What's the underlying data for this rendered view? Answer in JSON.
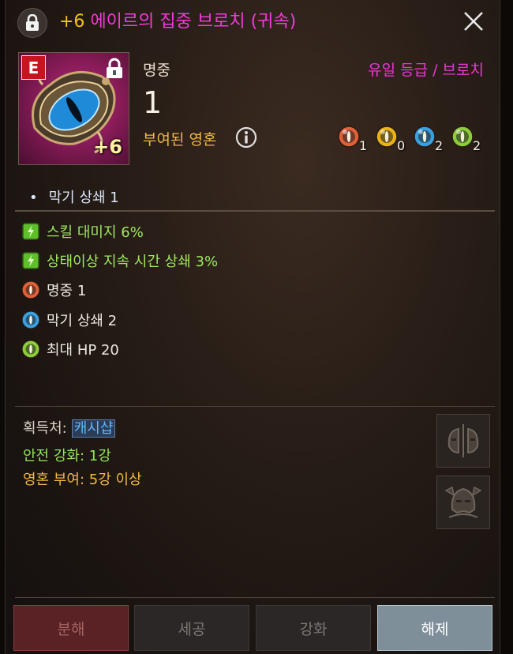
{
  "header": {
    "enhance_prefix": "+6",
    "item_name": "에이르의 집중 브로치 (귀속)",
    "plus_color": "#f3c21a",
    "name_color": "#f33ad9"
  },
  "item": {
    "grade_badge": "E",
    "enhance_badge": "+6",
    "icon": "eye-brooch-icon"
  },
  "main_stat": {
    "label": "명중",
    "value": "1"
  },
  "grade_type": "유일 등급 / 브로치",
  "soul": {
    "label": "부여된 영혼",
    "orbs": [
      {
        "color": "#e0603a",
        "count": "1"
      },
      {
        "color": "#e8b21a",
        "count": "0"
      },
      {
        "color": "#3aa0e0",
        "count": "2"
      },
      {
        "color": "#8dcc3a",
        "count": "2"
      }
    ]
  },
  "base_options": [
    "막기 상쇄  1"
  ],
  "bonus_options": [
    {
      "text": "스킬 대미지 6%",
      "icon": "skill-rune-icon",
      "color": "green"
    },
    {
      "text": "상태이상 지속 시간 상쇄 3%",
      "icon": "skill-rune-icon",
      "color": "green"
    },
    {
      "text": "명중  1",
      "icon": "red-soul-orb-icon",
      "color": "white"
    },
    {
      "text": "막기 상쇄  2",
      "icon": "blue-soul-orb-icon",
      "color": "white"
    },
    {
      "text": "최대 HP  20",
      "icon": "green-soul-orb-icon",
      "color": "white"
    }
  ],
  "acquisition": {
    "label": "획득처:",
    "link": "캐시샵"
  },
  "safe_enhance": "안전 강화: 1강",
  "soul_requirement": "영혼 부여: 5강 이상",
  "buttons": {
    "disassemble": "분해",
    "craft": "세공",
    "enhance": "강화",
    "release": "해제"
  }
}
